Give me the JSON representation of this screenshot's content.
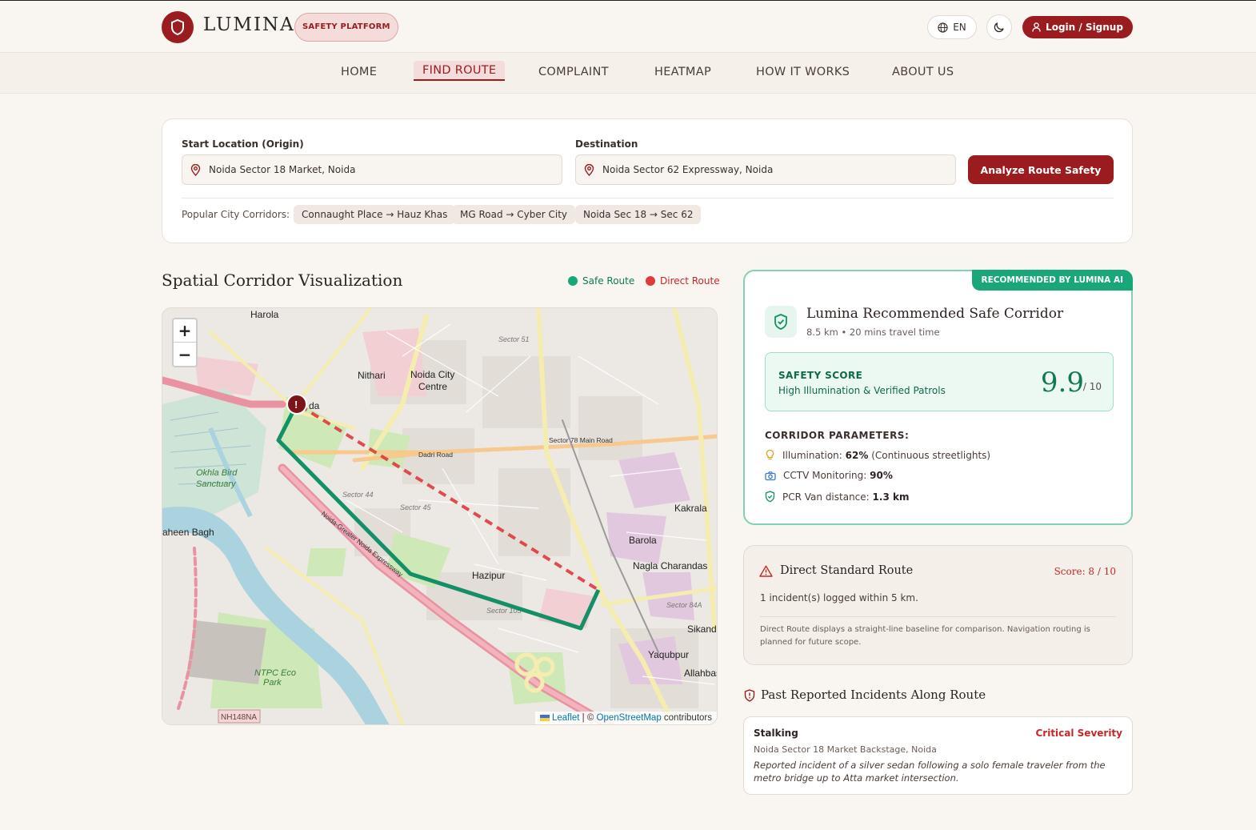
{
  "header": {
    "brand": "LUMINA",
    "platform_badge": "SAFETY PLATFORM",
    "language": "EN",
    "login_label": "Login / Signup"
  },
  "nav": {
    "items": [
      "HOME",
      "FIND ROUTE",
      "COMPLAINT",
      "HEATMAP",
      "HOW IT WORKS",
      "ABOUT US"
    ],
    "active": "FIND ROUTE"
  },
  "search": {
    "origin_label": "Start Location (Origin)",
    "origin_value": "Noida Sector 18 Market, Noida",
    "destination_label": "Destination",
    "destination_value": "Noida Sector 62 Expressway, Noida",
    "analyze_label": "Analyze Route Safety",
    "corridors_label": "Popular City Corridors:",
    "corridors": [
      "Connaught Place → Hauz Khas",
      "MG Road → Cyber City",
      "Noida Sec 18 → Sec 62"
    ]
  },
  "map": {
    "title": "Spatial Corridor Visualization",
    "legend": [
      {
        "label": "Safe Route",
        "color": "#19a679"
      },
      {
        "label": "Direct Route",
        "color": "#e0393e"
      }
    ],
    "zoom_in": "+",
    "zoom_out": "−",
    "attribution_leaflet": "Leaflet",
    "attribution_sep": " | © ",
    "attribution_osm": "OpenStreetMap",
    "attribution_tail": " contributors",
    "labels": {
      "harola": "Harola",
      "nithari": "Nithari",
      "noida_city_centre_1": "Noida City",
      "noida_city_centre_2": "Centre",
      "okhla_1": "Okhla Bird",
      "okhla_2": "Sanctuary",
      "shaheen": "aheen Bagh",
      "kakrala": "Kakrala",
      "barola": "Barola",
      "nagla": "Nagla Charandas",
      "hazipur": "Hazipur",
      "yaqubpur": "Yaqubpur",
      "sikand": "Sikand",
      "allahbas": "Allahbas",
      "ntpc_1": "NTPC Eco",
      "ntpc_2": "Park",
      "sector44": "Sector 44",
      "sector45": "Sector 45",
      "sector105": "Sector 105",
      "sector84a": "Sector 84A",
      "sector51": "Sector 51",
      "dadri_road": "Dadri Road",
      "sector78_road": "Sector 78 Main Road",
      "expressway": "Noida-Greater Noida Expressway",
      "nh": "NH148NA",
      "marker_text": "da",
      "marker_symbol": "!"
    }
  },
  "recommended": {
    "tag": "RECOMMENDED BY LUMINA AI",
    "title": "Lumina Recommended Safe Corridor",
    "subtitle": "8.5 km • 20 mins travel time",
    "score_label": "SAFETY SCORE",
    "score_desc": "High Illumination & Verified Patrols",
    "score_value": "9.9",
    "score_max": "/ 10",
    "params_title": "CORRIDOR PARAMETERS:",
    "params": [
      {
        "label": "Illumination: ",
        "value": "62%",
        "suffix": " (Continuous streetlights)",
        "icon": "bulb-icon"
      },
      {
        "label": "CCTV Monitoring: ",
        "value": "90%",
        "suffix": "",
        "icon": "camera-icon"
      },
      {
        "label": "PCR Van distance: ",
        "value": "1.3 km",
        "suffix": "",
        "icon": "shield-check-icon"
      }
    ]
  },
  "direct": {
    "title": "Direct Standard Route",
    "score": "Score: 8 / 10",
    "incidents": "1 incident(s) logged within 5 km.",
    "note": "Direct Route displays a straight-line baseline for comparison. Navigation routing is planned for future scope."
  },
  "incidents": {
    "title": "Past Reported Incidents Along Route",
    "items": [
      {
        "type": "Stalking",
        "severity": "Critical Severity",
        "location": "Noida Sector 18 Market Backstage, Noida",
        "description": "Reported incident of a silver sedan following a solo female traveler from the metro bridge up to Atta market intersection."
      }
    ]
  }
}
